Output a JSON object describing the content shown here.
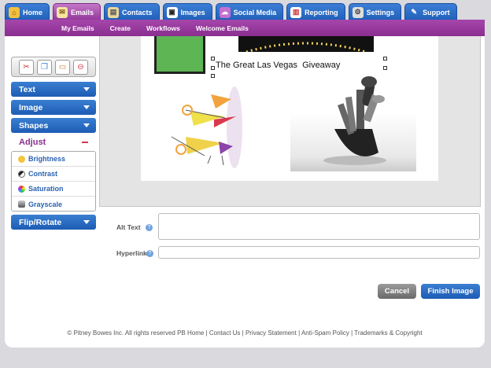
{
  "tabs": [
    {
      "label": "Home",
      "icon": "house-icon"
    },
    {
      "label": "Emails",
      "icon": "envelope-icon"
    },
    {
      "label": "Contacts",
      "icon": "contacts-icon"
    },
    {
      "label": "Images",
      "icon": "images-icon"
    },
    {
      "label": "Social Media",
      "icon": "social-icon"
    },
    {
      "label": "Reporting",
      "icon": "reporting-icon"
    },
    {
      "label": "Settings",
      "icon": "gear-icon"
    },
    {
      "label": "Support",
      "icon": "wrench-icon"
    }
  ],
  "subnav": [
    "My Emails",
    "Create",
    "Workflows",
    "Welcome Emails"
  ],
  "sidebar": {
    "sections": [
      "Text",
      "Image",
      "Shapes",
      "Flip/Rotate"
    ],
    "adjust_label": "Adjust",
    "adjust_items": [
      "Brightness",
      "Contrast",
      "Saturation",
      "Grayscale"
    ]
  },
  "canvas": {
    "caption": "The Great Las Vegas  Giveaway"
  },
  "form": {
    "alt_text_label": "Alt Text",
    "alt_text_value": "",
    "hyperlink_label": "Hyperlink",
    "hyperlink_value": ""
  },
  "buttons": {
    "cancel": "Cancel",
    "finish": "Finish Image"
  },
  "footer": "© Pitney Bowes Inc. All rights reserved PB Home | Contact Us | Privacy Statement | Anti-Spam Policy | Trademarks & Copyright"
}
